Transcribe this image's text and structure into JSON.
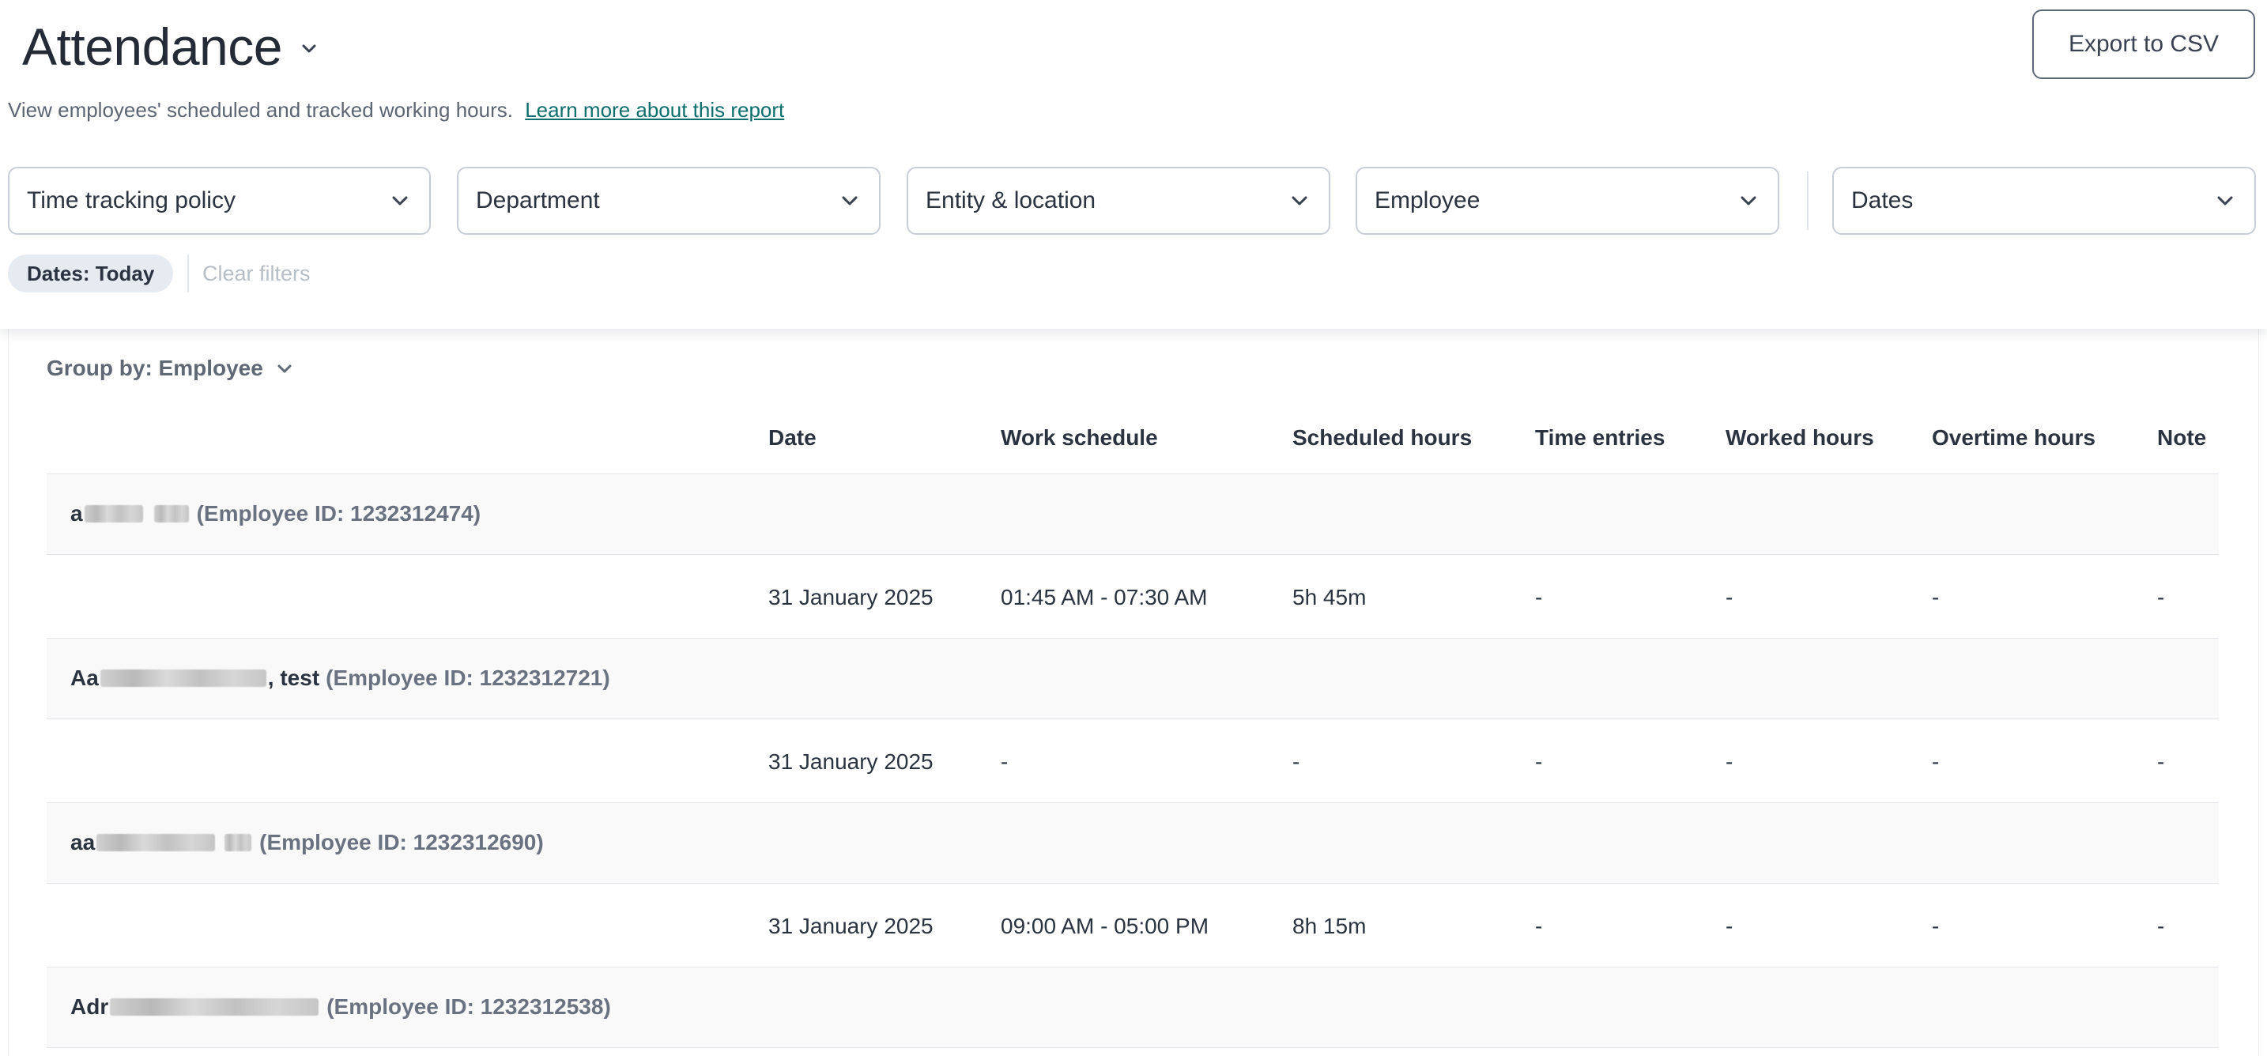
{
  "header": {
    "title": "Attendance",
    "export_label": "Export to CSV",
    "subtitle": "View employees' scheduled and tracked working hours.",
    "learn_more_link": "Learn more about this report"
  },
  "filters": [
    {
      "label": "Time tracking policy"
    },
    {
      "label": "Department"
    },
    {
      "label": "Entity & location"
    },
    {
      "label": "Employee"
    },
    {
      "label": "Dates"
    }
  ],
  "active_filter_chip": "Dates: Today",
  "clear_filters_label": "Clear filters",
  "group_by_label": "Group by: Employee",
  "table": {
    "columns": [
      "Date",
      "Work schedule",
      "Scheduled hours",
      "Time entries",
      "Worked hours",
      "Overtime hours",
      "Note"
    ],
    "groups": [
      {
        "name_prefix": "a",
        "name_suffix": "",
        "employee_id": "(Employee ID: 1232312474)",
        "rows": [
          {
            "date": "31 January 2025",
            "work_schedule": "01:45 AM - 07:30 AM",
            "scheduled_hours": "5h 45m",
            "time_entries": "-",
            "worked_hours": "-",
            "overtime_hours": "-",
            "note": "-"
          }
        ]
      },
      {
        "name_prefix": "Aa",
        "name_suffix": ", test",
        "employee_id": "(Employee ID: 1232312721)",
        "rows": [
          {
            "date": "31 January 2025",
            "work_schedule": "-",
            "scheduled_hours": "-",
            "time_entries": "-",
            "worked_hours": "-",
            "overtime_hours": "-",
            "note": "-"
          }
        ]
      },
      {
        "name_prefix": "aa",
        "name_suffix": "",
        "employee_id": "(Employee ID: 1232312690)",
        "rows": [
          {
            "date": "31 January 2025",
            "work_schedule": "09:00 AM - 05:00 PM",
            "scheduled_hours": "8h 15m",
            "time_entries": "-",
            "worked_hours": "-",
            "overtime_hours": "-",
            "note": "-"
          }
        ]
      },
      {
        "name_prefix": "Adr",
        "name_suffix": "",
        "employee_id": "(Employee ID: 1232312538)",
        "rows": []
      }
    ]
  },
  "icons": {
    "title_dropdown": "chevron-down-icon",
    "filter_dropdown": "chevron-down-icon",
    "group_by_dropdown": "chevron-down-icon"
  },
  "colors": {
    "link": "#0d6e6e",
    "group_row_bg": "#f9f9f9",
    "chip_bg": "#e6ebf1"
  }
}
